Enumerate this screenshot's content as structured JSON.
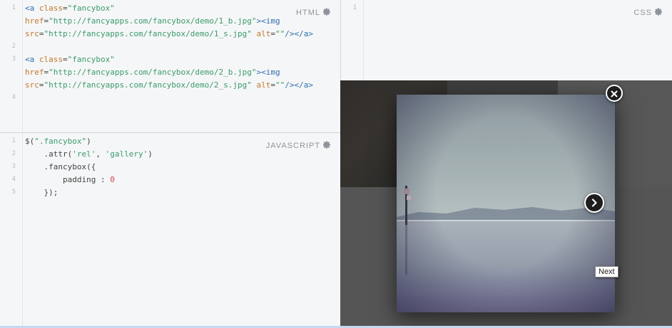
{
  "html_pane": {
    "label": "HTML",
    "line_numbers": [
      "1",
      "2",
      "3",
      "4"
    ],
    "lines": [
      {
        "segments": [
          {
            "text": "<a ",
            "cls": "tag"
          },
          {
            "text": "class",
            "cls": "attr"
          },
          {
            "text": "=",
            "cls": "plain"
          },
          {
            "text": "\"fancybox\"",
            "cls": "str"
          }
        ]
      },
      {
        "segments": [
          {
            "text": "href",
            "cls": "attr"
          },
          {
            "text": "=",
            "cls": "plain"
          },
          {
            "text": "\"http://fancyapps.com/fancybox/demo/1_b.jpg\"",
            "cls": "str"
          },
          {
            "text": "><img",
            "cls": "tag"
          }
        ]
      },
      {
        "segments": [
          {
            "text": "src",
            "cls": "attr"
          },
          {
            "text": "=",
            "cls": "plain"
          },
          {
            "text": "\"http://fancyapps.com/fancybox/demo/1_s.jpg\"",
            "cls": "str"
          },
          {
            "text": " alt",
            "cls": "attr"
          },
          {
            "text": "=",
            "cls": "plain"
          },
          {
            "text": "\"\"",
            "cls": "str"
          },
          {
            "text": "/></a>",
            "cls": "tag"
          }
        ]
      },
      {
        "segments": []
      },
      {
        "segments": [
          {
            "text": "<a ",
            "cls": "tag"
          },
          {
            "text": "class",
            "cls": "attr"
          },
          {
            "text": "=",
            "cls": "plain"
          },
          {
            "text": "\"fancybox\"",
            "cls": "str"
          }
        ]
      },
      {
        "segments": [
          {
            "text": "href",
            "cls": "attr"
          },
          {
            "text": "=",
            "cls": "plain"
          },
          {
            "text": "\"http://fancyapps.com/fancybox/demo/2_b.jpg\"",
            "cls": "str"
          },
          {
            "text": "><img",
            "cls": "tag"
          }
        ]
      },
      {
        "segments": [
          {
            "text": "src",
            "cls": "attr"
          },
          {
            "text": "=",
            "cls": "plain"
          },
          {
            "text": "\"http://fancyapps.com/fancybox/demo/2_s.jpg\"",
            "cls": "str"
          },
          {
            "text": " alt",
            "cls": "attr"
          },
          {
            "text": "=",
            "cls": "plain"
          },
          {
            "text": "\"\"",
            "cls": "str"
          },
          {
            "text": "/></a>",
            "cls": "tag"
          }
        ]
      }
    ]
  },
  "css_pane": {
    "label": "CSS",
    "line_numbers": [
      "1"
    ]
  },
  "js_pane": {
    "label": "JAVASCRIPT",
    "line_numbers": [
      "1",
      "2",
      "3",
      "4",
      "5"
    ],
    "lines": [
      {
        "segments": [
          {
            "text": "$(",
            "cls": "plain"
          },
          {
            "text": "\".fancybox\"",
            "cls": "str"
          },
          {
            "text": ")",
            "cls": "plain"
          }
        ]
      },
      {
        "segments": [
          {
            "text": "    .attr(",
            "cls": "plain"
          },
          {
            "text": "'rel'",
            "cls": "str"
          },
          {
            "text": ", ",
            "cls": "plain"
          },
          {
            "text": "'gallery'",
            "cls": "str"
          },
          {
            "text": ")",
            "cls": "plain"
          }
        ]
      },
      {
        "segments": [
          {
            "text": "    .fancybox({",
            "cls": "plain"
          }
        ]
      },
      {
        "segments": [
          {
            "text": "        padding : ",
            "cls": "plain"
          },
          {
            "text": "0",
            "cls": "num"
          }
        ]
      },
      {
        "segments": [
          {
            "text": "    });",
            "cls": "plain"
          }
        ]
      }
    ]
  },
  "lightbox": {
    "tooltip": "Next",
    "icons": {
      "close": "close-icon",
      "next": "chevron-right-icon",
      "settings": "gear-icon"
    }
  },
  "colors": {
    "tag": "#2e6fb0",
    "attribute": "#c0782c",
    "string": "#3a9b6c",
    "number": "#d0443f",
    "pane_bg": "#f5f6f7",
    "accent_line": "#c7d9f1"
  }
}
